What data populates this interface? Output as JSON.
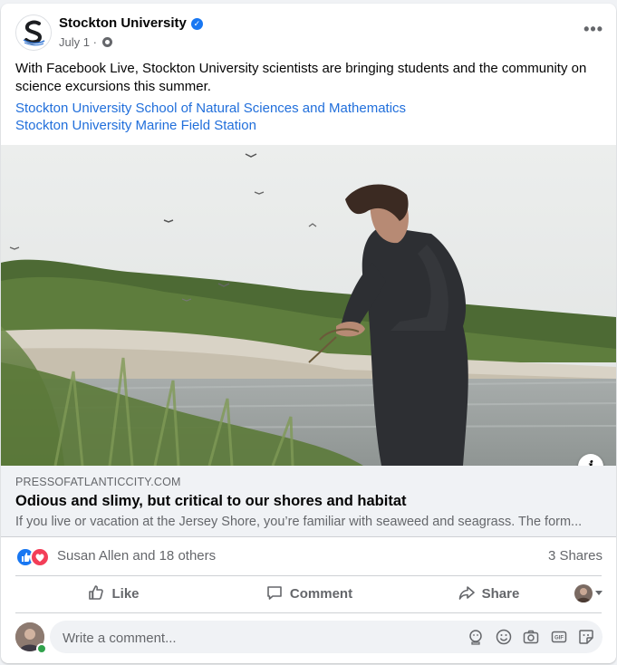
{
  "post": {
    "page_name": "Stockton University",
    "date": "July 1",
    "separator": "·",
    "text": "With Facebook Live, Stockton University scientists are bringing students and the community on science excursions this summer.",
    "tags": [
      "Stockton University School of Natural Sciences and Mathematics",
      "Stockton University Marine Field Station"
    ]
  },
  "link_preview": {
    "domain": "PRESSOFATLANTICCITY.COM",
    "title": "Odious and slimy, but critical to our shores and habitat",
    "description": "If you live or vacation at the Jersey Shore, you’re familiar with seaweed and seagrass. The form..."
  },
  "engagement": {
    "reactions": [
      "like",
      "love"
    ],
    "names": "Susan Allen and 18 others",
    "shares": "3 Shares"
  },
  "actions": {
    "like": "Like",
    "comment": "Comment",
    "share": "Share"
  },
  "comment": {
    "placeholder": "Write a comment..."
  },
  "icons": {
    "more": "more-options-icon",
    "privacy": "globe-icon",
    "verified": "verified-badge-icon",
    "comment_tools": [
      "avatar-sticker-icon",
      "emoji-icon",
      "camera-icon",
      "gif-icon",
      "sticker-icon"
    ]
  },
  "colors": {
    "link": "#216fdb",
    "like_blue": "#1877f2",
    "love_red": "#f33e58",
    "secondary_text": "#65676b"
  }
}
